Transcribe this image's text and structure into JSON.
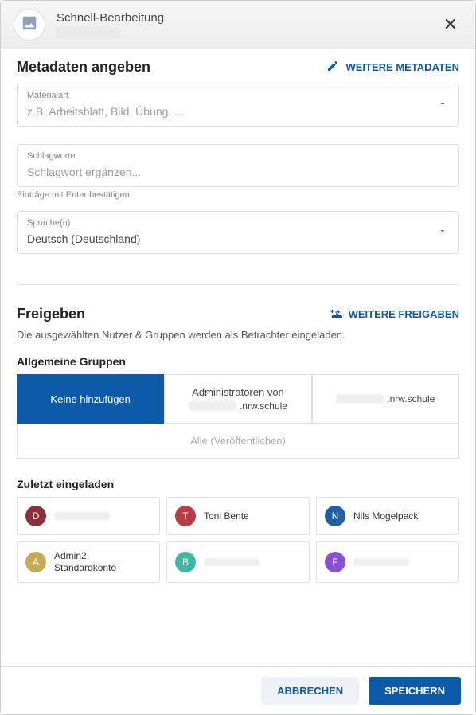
{
  "header": {
    "title": "Schnell-Bearbeitung"
  },
  "metadata": {
    "section_title": "Metadaten angeben",
    "more_link": "WEITERE METADATEN",
    "material": {
      "label": "Materialart",
      "placeholder": "z.B. Arbeitsblatt, Bild, Übung, ..."
    },
    "tags": {
      "label": "Schlagworte",
      "placeholder": "Schlagwort ergänzen...",
      "helper": "Einträge mit Enter bestätigen"
    },
    "language": {
      "label": "Sprache(n)",
      "value": "Deutsch (Deutschland)"
    }
  },
  "share": {
    "section_title": "Freigeben",
    "more_link": "WEITERE FREIGABEN",
    "description": "Die ausgewählten Nutzer & Gruppen werden als Betrachter eingeladen.",
    "groups_title": "Allgemeine Gruppen",
    "groups": {
      "none": "Keine hinzufügen",
      "admins_line1": "Administratoren von",
      "admins_line2": ".nrw.schule",
      "school_suffix": ".nrw.schule",
      "all": "Alle (Veröffentlichen)"
    },
    "recent_title": "Zuletzt eingeladen",
    "users": [
      {
        "initial": "D",
        "color": "#8b2f3a",
        "name": ""
      },
      {
        "initial": "T",
        "color": "#b73c43",
        "name": "Toni Bente"
      },
      {
        "initial": "N",
        "color": "#1f5fa8",
        "name": "Nils Mogelpack"
      },
      {
        "initial": "A",
        "color": "#c7a951",
        "name": "Admin2 Standardkonto"
      },
      {
        "initial": "B",
        "color": "#3fb8a1",
        "name": ""
      },
      {
        "initial": "F",
        "color": "#8a4fd8",
        "name": ""
      }
    ]
  },
  "footer": {
    "cancel": "ABBRECHEN",
    "save": "SPEICHERN"
  }
}
